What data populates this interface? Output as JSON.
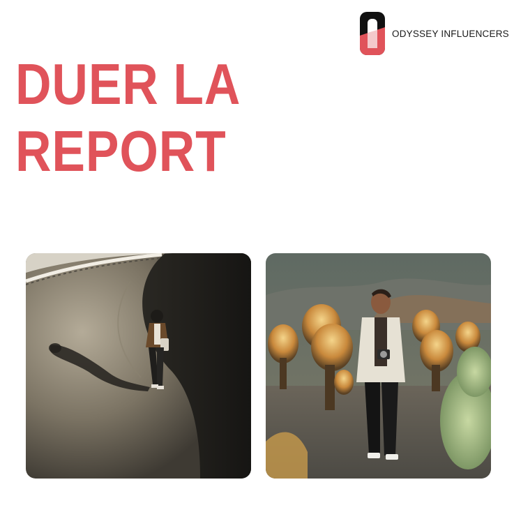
{
  "brand": {
    "name": "ODYSSEY INFLUENCERS",
    "accent_color": "#e0535a",
    "logo_icon": "odyssey-o-logo-icon"
  },
  "headline": {
    "line1": "DUER LA",
    "line2": "REPORT"
  },
  "photos": [
    {
      "subject": "man-walking-in-skate-bowl-photo"
    },
    {
      "subject": "man-in-cholla-cactus-desert-photo"
    }
  ]
}
